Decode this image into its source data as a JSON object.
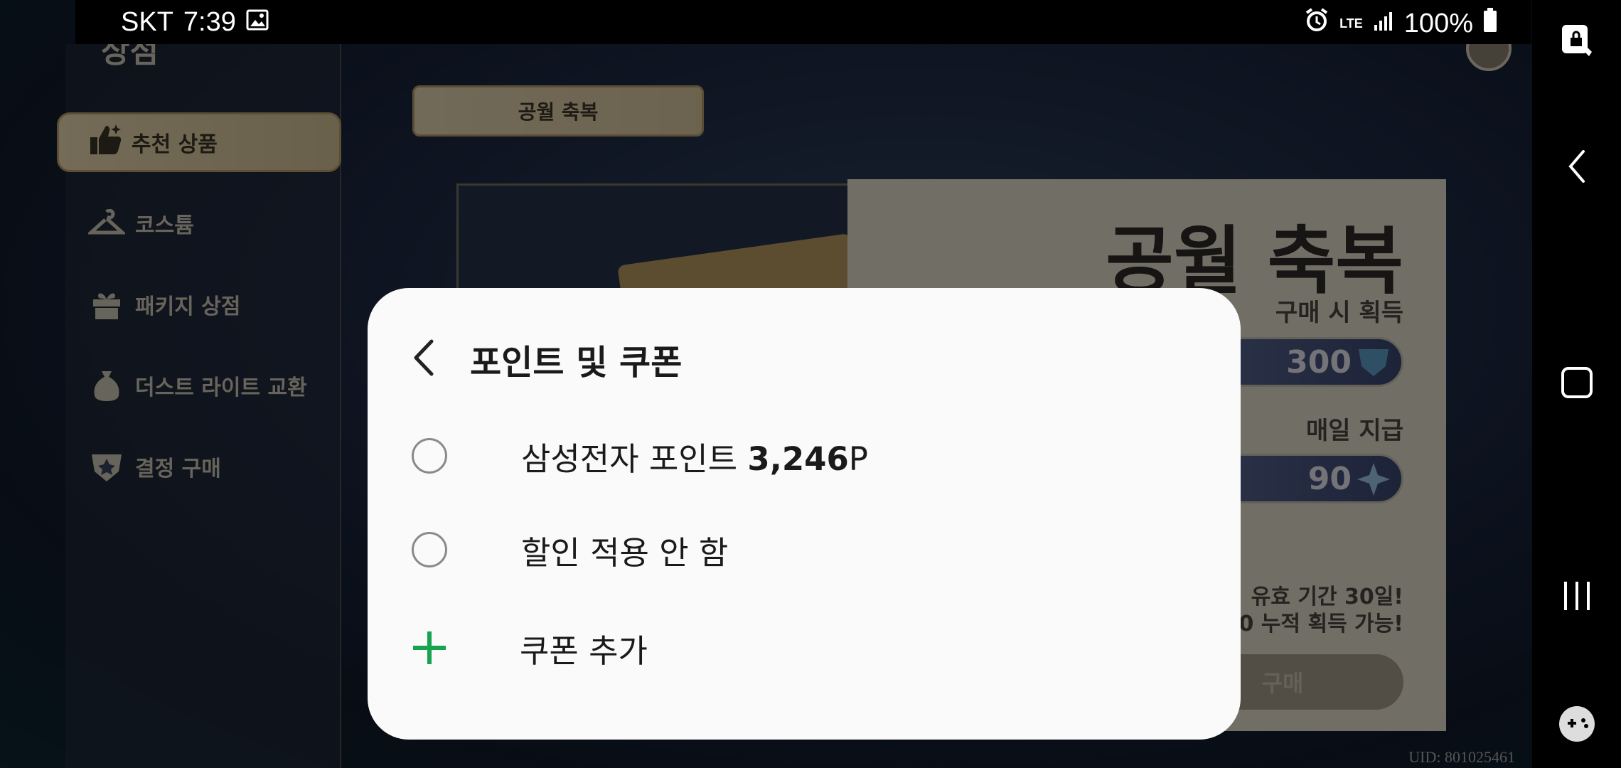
{
  "status_bar": {
    "carrier": "SKT",
    "time": "7:39",
    "network": "LTE",
    "battery": "100%"
  },
  "game": {
    "panel_title": "상점",
    "menu": [
      {
        "label": "추천 상품",
        "icon": "thumbs-up-icon",
        "active": true
      },
      {
        "label": "코스튬",
        "icon": "hanger-icon",
        "active": false
      },
      {
        "label": "패키지 상점",
        "icon": "gift-icon",
        "active": false
      },
      {
        "label": "더스트 라이트 교환",
        "icon": "pouch-icon",
        "active": false
      },
      {
        "label": "결정 구매",
        "icon": "crystal-icon",
        "active": false
      }
    ],
    "top_tab": "공월 축복",
    "promo": {
      "title": "공월 축복",
      "purchase_label": "구매 시 획득",
      "purchase_amount": "300",
      "daily_label": "매일 지급",
      "daily_amount": "90",
      "note_line1": "유효 기간 30일!",
      "note_line2": "0 누적 획득 가능!",
      "buy_label": "구매"
    },
    "uid": "UID: 801025461"
  },
  "dialog": {
    "title": "포인트 및 쿠폰",
    "options": [
      {
        "label": "삼성전자 포인트 ",
        "amount": "3,246",
        "unit": "P",
        "selected": false
      },
      {
        "label": "할인 적용 안 함",
        "selected": false
      }
    ],
    "add_coupon": "쿠폰 추가"
  },
  "colors": {
    "accent_green": "#16a44f",
    "dialog_bg": "#fafafa"
  }
}
